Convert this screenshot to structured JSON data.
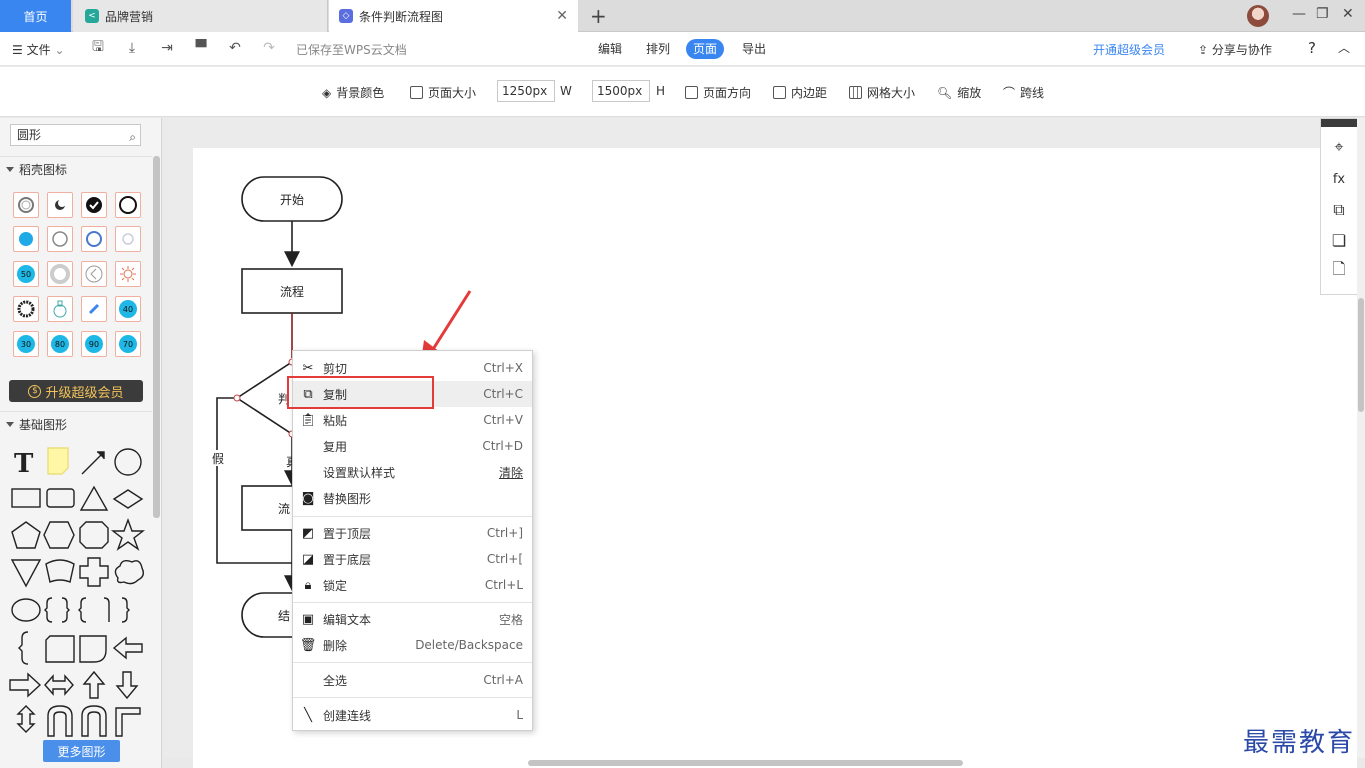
{
  "tabs": {
    "home": "首页",
    "brand": "品牌营销",
    "flow": "条件判断流程图",
    "add_icon": "plus-icon",
    "close_icon": "close-icon"
  },
  "window": {
    "count": "2"
  },
  "toolbar1": {
    "file_menu": "文件",
    "saved_status": "已保存至WPS云文档",
    "menu_tabs": [
      "编辑",
      "排列",
      "页面",
      "导出"
    ],
    "active_tab": "页面",
    "vip_link": "开通超级会员",
    "share": "分享与协作",
    "help": "?"
  },
  "toolbar2": {
    "bg_color": "背景颜色",
    "page_size": "页面大小",
    "width_value": "1250px",
    "width_label": "W",
    "height_value": "1500px",
    "height_label": "H",
    "orientation": "页面方向",
    "padding": "内边距",
    "grid_size": "网格大小",
    "zoom": "缩放",
    "jump_line": "跨线"
  },
  "left_panel": {
    "search_value": "圆形",
    "section1_title": "稻壳图标",
    "upgrade_button": "升级超级会员",
    "section2_title": "基础图形",
    "more_shapes": "更多图形",
    "icon_labels": [
      "50",
      "40",
      "30",
      "80",
      "90",
      "70"
    ]
  },
  "flowchart": {
    "start": "开始",
    "process1": "流程",
    "decision_partial": "判",
    "false_label": "假",
    "true_partial": "真",
    "process2_partial": "流",
    "end_partial": "结"
  },
  "context_menu": {
    "items": [
      {
        "label": "剪切",
        "key": "Ctrl+X",
        "icon": "scissors-icon"
      },
      {
        "label": "复制",
        "key": "Ctrl+C",
        "icon": "copy-icon"
      },
      {
        "label": "粘贴",
        "key": "Ctrl+V",
        "icon": "paste-icon"
      },
      {
        "label": "复用",
        "key": "Ctrl+D",
        "icon": ""
      },
      {
        "label": "设置默认样式",
        "key": "清除",
        "icon": ""
      },
      {
        "label": "替换图形",
        "key": "",
        "icon": "replace-shape-icon"
      },
      {
        "label": "置于顶层",
        "key": "Ctrl+]",
        "icon": "bring-front-icon"
      },
      {
        "label": "置于底层",
        "key": "Ctrl+[",
        "icon": "send-back-icon"
      },
      {
        "label": "锁定",
        "key": "Ctrl+L",
        "icon": "lock-icon"
      },
      {
        "label": "编辑文本",
        "key": "空格",
        "icon": "edit-text-icon"
      },
      {
        "label": "删除",
        "key": "Delete/Backspace",
        "icon": "trash-icon"
      },
      {
        "label": "全选",
        "key": "Ctrl+A",
        "icon": ""
      },
      {
        "label": "创建连线",
        "key": "L",
        "icon": "connector-line-icon"
      }
    ],
    "highlighted": "复制"
  },
  "watermark": "最需教育",
  "colors": {
    "accent": "#3a86f0",
    "highlight_box": "#e53a3a",
    "arrow": "#e53a3a"
  }
}
